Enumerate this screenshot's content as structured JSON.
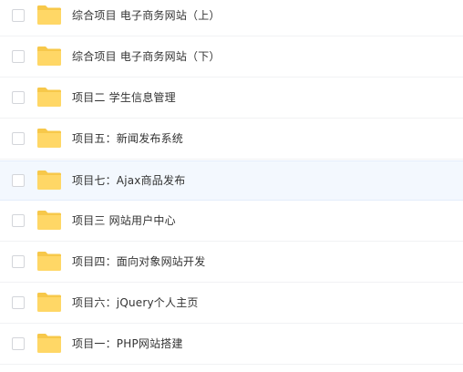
{
  "file_list": {
    "items": [
      {
        "name": "综合项目 电子商务网站（上）",
        "type": "folder",
        "checked": false,
        "hovered": false
      },
      {
        "name": "综合项目 电子商务网站（下）",
        "type": "folder",
        "checked": false,
        "hovered": false
      },
      {
        "name": "项目二 学生信息管理",
        "type": "folder",
        "checked": false,
        "hovered": false
      },
      {
        "name": "项目五：新闻发布系统",
        "type": "folder",
        "checked": false,
        "hovered": false
      },
      {
        "name": "项目七：Ajax商品发布",
        "type": "folder",
        "checked": false,
        "hovered": true
      },
      {
        "name": "项目三 网站用户中心",
        "type": "folder",
        "checked": false,
        "hovered": false
      },
      {
        "name": "项目四：面向对象网站开发",
        "type": "folder",
        "checked": false,
        "hovered": false
      },
      {
        "name": "项目六：jQuery个人主页",
        "type": "folder",
        "checked": false,
        "hovered": false
      },
      {
        "name": "项目一：PHP网站搭建",
        "type": "folder",
        "checked": false,
        "hovered": false
      }
    ]
  },
  "colors": {
    "folder_body": "#ffd766",
    "folder_tab": "#f7c84a",
    "hover_bg": "#f3f8fe",
    "text": "#333333",
    "checkbox_border": "#d3d5da"
  },
  "icons": {
    "folder": "folder-icon",
    "checkbox": "checkbox"
  }
}
